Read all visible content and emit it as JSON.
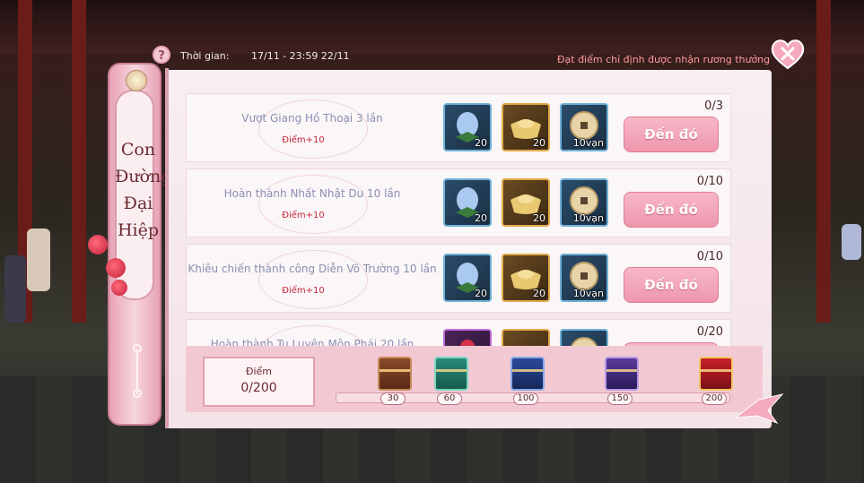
{
  "header": {
    "time_label": "Thời gian:",
    "time_value": "17/11 - 23:59 22/11",
    "tip": "Đạt điểm chỉ định được nhận rương thưởng"
  },
  "side": {
    "title_lines": [
      "Con",
      "Đường",
      "Đại",
      "Hiệp"
    ]
  },
  "tasks": [
    {
      "title": "Vượt Giang Hồ Thoại 3 lần",
      "points": "Điểm+10",
      "progress": "0/3",
      "rewards": [
        {
          "qty": "20",
          "icon": "lotus-fruit-icon"
        },
        {
          "qty": "20",
          "icon": "gold-ingot-icon"
        },
        {
          "qty": "10vạn",
          "icon": "copper-coin-icon"
        }
      ],
      "button": "Đến đó"
    },
    {
      "title": "Hoàn thành Nhất Nhật Du 10 lần",
      "points": "Điểm+10",
      "progress": "0/10",
      "rewards": [
        {
          "qty": "20",
          "icon": "lotus-fruit-icon"
        },
        {
          "qty": "20",
          "icon": "gold-ingot-icon"
        },
        {
          "qty": "10vạn",
          "icon": "copper-coin-icon"
        }
      ],
      "button": "Đến đó"
    },
    {
      "title": "Khiêu chiến thành công Diễn Võ Trường 10 lần",
      "points": "Điểm+10",
      "progress": "0/10",
      "rewards": [
        {
          "qty": "20",
          "icon": "lotus-fruit-icon"
        },
        {
          "qty": "20",
          "icon": "gold-ingot-icon"
        },
        {
          "qty": "10vạn",
          "icon": "copper-coin-icon"
        }
      ],
      "button": "Đến đó"
    },
    {
      "title": "Hoàn thành Tu Luyện Môn Phái 20 lần",
      "points": "",
      "progress": "0/20",
      "rewards": [
        {
          "qty": "",
          "icon": "red-charm-icon"
        },
        {
          "qty": "",
          "icon": "gold-ingot-icon"
        },
        {
          "qty": "",
          "icon": "copper-coin-icon"
        }
      ],
      "button": ""
    }
  ],
  "score": {
    "label": "Điểm",
    "value": "0/200"
  },
  "milestones": [
    "30",
    "60",
    "100",
    "150",
    "200"
  ],
  "colors": {
    "accent_pink": "#ee97ad",
    "points_red": "#c2243a",
    "tip_red": "#ff9a9a"
  }
}
